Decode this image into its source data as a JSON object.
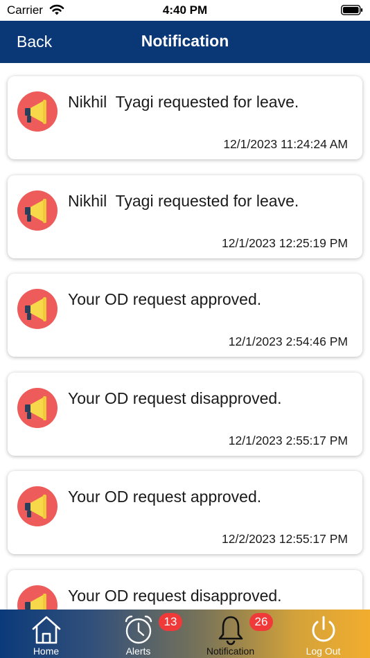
{
  "status_bar": {
    "carrier": "Carrier",
    "time": "4:40 PM"
  },
  "nav": {
    "back_label": "Back",
    "title": "Notification"
  },
  "notifications": [
    {
      "message": "Nikhil  Tyagi requested for leave.",
      "timestamp": "12/1/2023 11:24:24 AM",
      "icon": "megaphone-icon"
    },
    {
      "message": "Nikhil  Tyagi requested for leave.",
      "timestamp": "12/1/2023 12:25:19 PM",
      "icon": "megaphone-icon"
    },
    {
      "message": "Your OD request approved.",
      "timestamp": "12/1/2023 2:54:46 PM",
      "icon": "megaphone-icon"
    },
    {
      "message": "Your OD request disapproved.",
      "timestamp": "12/1/2023 2:55:17 PM",
      "icon": "megaphone-icon"
    },
    {
      "message": "Your OD request approved.",
      "timestamp": "12/2/2023 12:55:17 PM",
      "icon": "megaphone-icon"
    },
    {
      "message": "Your OD request disapproved.",
      "timestamp": "",
      "icon": "megaphone-icon"
    }
  ],
  "tab_bar": {
    "home": {
      "label": "Home",
      "icon": "home-icon"
    },
    "alerts": {
      "label": "Alerts",
      "badge": "13",
      "icon": "alarm-clock-icon"
    },
    "notification": {
      "label": "Notification",
      "badge": "26",
      "icon": "bell-icon"
    },
    "logout": {
      "label": "Log Out",
      "icon": "power-icon"
    }
  },
  "colors": {
    "nav_bar": "#0a3776",
    "badge": "#f03a3a",
    "icon_circle": "#ee5b5b",
    "megaphone": "#f7d84a"
  }
}
